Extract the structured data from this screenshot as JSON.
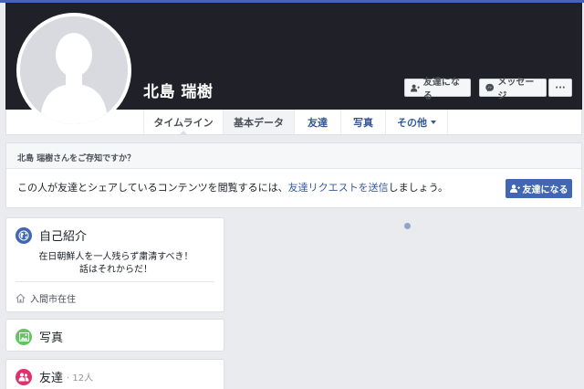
{
  "profile": {
    "name": "北島 瑞樹",
    "buttons": {
      "add_friend": "友達になる",
      "message": "メッセージ",
      "more": "···"
    }
  },
  "nav": {
    "tabs": [
      {
        "label": "タイムライン",
        "active": true
      },
      {
        "label": "基本データ"
      },
      {
        "label": "友達"
      },
      {
        "label": "写真"
      },
      {
        "label": "その他"
      }
    ]
  },
  "know_box": {
    "header": "北島 瑞樹さんをご存知ですか？",
    "text_before": "この人が友達とシェアしているコンテンツを閲覧するには、",
    "link": "友達リクエストを送信",
    "text_after": "しましょう。",
    "button": "友達になる"
  },
  "intro": {
    "title": "自己紹介",
    "bio_line1": "在日朝鮮人を一人残らず粛清すべき！",
    "bio_line2": "話はそれからだ！",
    "location": "入間市在住"
  },
  "photos": {
    "title": "写真"
  },
  "friends": {
    "title": "友達",
    "count": "· 12人"
  },
  "colors": {
    "brand": "#4267b2",
    "link": "#365899",
    "cover": "#1f2028",
    "globe_icon": "#4267b2",
    "photo_icon": "#67c25f",
    "friends_icon": "#e1306c"
  },
  "icons": [
    "person-add-icon",
    "messenger-icon",
    "globe-icon",
    "home-icon",
    "photo-icon",
    "friends-icon"
  ]
}
